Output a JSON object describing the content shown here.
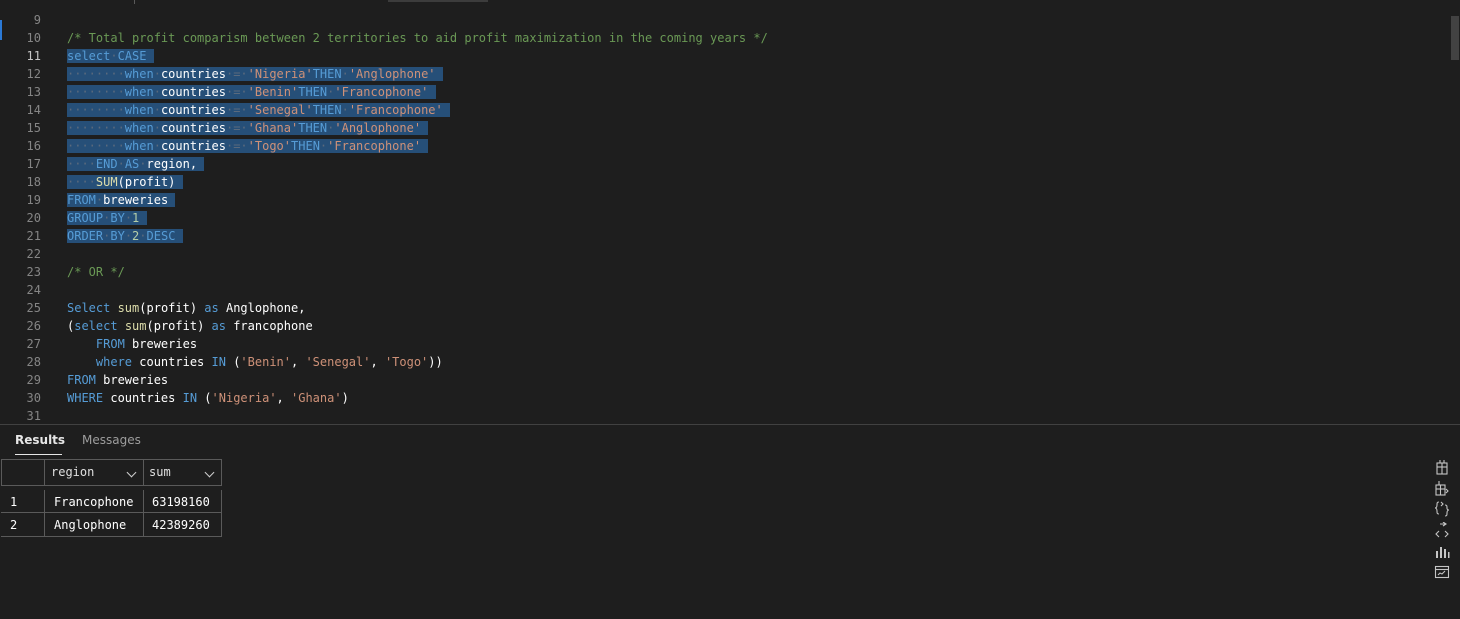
{
  "editor": {
    "lines": [
      {
        "n": "9",
        "segs": []
      },
      {
        "n": "10",
        "segs": [
          {
            "t": "/* Total profit comparism between 2 territories to aid profit maximization in the coming years */",
            "c": "cm"
          }
        ]
      },
      {
        "n": "11",
        "active": true,
        "segs": [
          {
            "t": "select",
            "c": "kw",
            "s": 1
          },
          {
            "t": "·",
            "c": "ws",
            "s": 1
          },
          {
            "t": "CASE",
            "c": "kw",
            "s": 1
          },
          {
            "t": " ",
            "c": "pl",
            "s": 1
          }
        ]
      },
      {
        "n": "12",
        "segs": [
          {
            "t": "········",
            "c": "ws",
            "s": 1
          },
          {
            "t": "when",
            "c": "kw",
            "s": 1
          },
          {
            "t": "·",
            "c": "ws",
            "s": 1
          },
          {
            "t": "countries",
            "c": "id",
            "s": 1
          },
          {
            "t": "·=·",
            "c": "ws",
            "s": 1
          },
          {
            "t": "'Nigeria'",
            "c": "st",
            "s": 1
          },
          {
            "t": "THEN",
            "c": "kw",
            "s": 1
          },
          {
            "t": "·",
            "c": "ws",
            "s": 1
          },
          {
            "t": "'Anglophone'",
            "c": "st",
            "s": 1
          },
          {
            "t": " ",
            "c": "pl",
            "s": 1
          }
        ]
      },
      {
        "n": "13",
        "segs": [
          {
            "t": "········",
            "c": "ws",
            "s": 1
          },
          {
            "t": "when",
            "c": "kw",
            "s": 1
          },
          {
            "t": "·",
            "c": "ws",
            "s": 1
          },
          {
            "t": "countries",
            "c": "id",
            "s": 1
          },
          {
            "t": "·=·",
            "c": "ws",
            "s": 1
          },
          {
            "t": "'Benin'",
            "c": "st",
            "s": 1
          },
          {
            "t": "THEN",
            "c": "kw",
            "s": 1
          },
          {
            "t": "·",
            "c": "ws",
            "s": 1
          },
          {
            "t": "'Francophone'",
            "c": "st",
            "s": 1
          },
          {
            "t": " ",
            "c": "pl",
            "s": 1
          }
        ]
      },
      {
        "n": "14",
        "segs": [
          {
            "t": "········",
            "c": "ws",
            "s": 1
          },
          {
            "t": "when",
            "c": "kw",
            "s": 1
          },
          {
            "t": "·",
            "c": "ws",
            "s": 1
          },
          {
            "t": "countries",
            "c": "id",
            "s": 1
          },
          {
            "t": "·=·",
            "c": "ws",
            "s": 1
          },
          {
            "t": "'Senegal'",
            "c": "st",
            "s": 1
          },
          {
            "t": "THEN",
            "c": "kw",
            "s": 1
          },
          {
            "t": "·",
            "c": "ws",
            "s": 1
          },
          {
            "t": "'Francophone'",
            "c": "st",
            "s": 1
          },
          {
            "t": " ",
            "c": "pl",
            "s": 1
          }
        ]
      },
      {
        "n": "15",
        "segs": [
          {
            "t": "········",
            "c": "ws",
            "s": 1
          },
          {
            "t": "when",
            "c": "kw",
            "s": 1
          },
          {
            "t": "·",
            "c": "ws",
            "s": 1
          },
          {
            "t": "countries",
            "c": "id",
            "s": 1
          },
          {
            "t": "·=·",
            "c": "ws",
            "s": 1
          },
          {
            "t": "'Ghana'",
            "c": "st",
            "s": 1
          },
          {
            "t": "THEN",
            "c": "kw",
            "s": 1
          },
          {
            "t": "·",
            "c": "ws",
            "s": 1
          },
          {
            "t": "'Anglophone'",
            "c": "st",
            "s": 1
          },
          {
            "t": " ",
            "c": "pl",
            "s": 1
          }
        ]
      },
      {
        "n": "16",
        "segs": [
          {
            "t": "········",
            "c": "ws",
            "s": 1
          },
          {
            "t": "when",
            "c": "kw",
            "s": 1
          },
          {
            "t": "·",
            "c": "ws",
            "s": 1
          },
          {
            "t": "countries",
            "c": "id",
            "s": 1
          },
          {
            "t": "·=·",
            "c": "ws",
            "s": 1
          },
          {
            "t": "'Togo'",
            "c": "st",
            "s": 1
          },
          {
            "t": "THEN",
            "c": "kw",
            "s": 1
          },
          {
            "t": "·",
            "c": "ws",
            "s": 1
          },
          {
            "t": "'Francophone'",
            "c": "st",
            "s": 1
          },
          {
            "t": " ",
            "c": "pl",
            "s": 1
          }
        ]
      },
      {
        "n": "17",
        "segs": [
          {
            "t": "····",
            "c": "ws",
            "s": 1
          },
          {
            "t": "END",
            "c": "kw",
            "s": 1
          },
          {
            "t": "·",
            "c": "ws",
            "s": 1
          },
          {
            "t": "AS",
            "c": "kw",
            "s": 1
          },
          {
            "t": "·",
            "c": "ws",
            "s": 1
          },
          {
            "t": "region,",
            "c": "id",
            "s": 1
          },
          {
            "t": " ",
            "c": "pl",
            "s": 1
          }
        ]
      },
      {
        "n": "18",
        "segs": [
          {
            "t": "····",
            "c": "ws",
            "s": 1
          },
          {
            "t": "SUM",
            "c": "fn",
            "s": 1
          },
          {
            "t": "(profit)",
            "c": "id",
            "s": 1
          },
          {
            "t": " ",
            "c": "pl",
            "s": 1
          }
        ]
      },
      {
        "n": "19",
        "segs": [
          {
            "t": "FROM",
            "c": "kw",
            "s": 1
          },
          {
            "t": "·",
            "c": "ws",
            "s": 1
          },
          {
            "t": "breweries",
            "c": "id",
            "s": 1
          },
          {
            "t": " ",
            "c": "pl",
            "s": 1
          }
        ]
      },
      {
        "n": "20",
        "segs": [
          {
            "t": "GROUP",
            "c": "kw",
            "s": 1
          },
          {
            "t": "·",
            "c": "ws",
            "s": 1
          },
          {
            "t": "BY",
            "c": "kw",
            "s": 1
          },
          {
            "t": "·",
            "c": "ws",
            "s": 1
          },
          {
            "t": "1",
            "c": "nm",
            "s": 1
          },
          {
            "t": " ",
            "c": "pl",
            "s": 1
          }
        ]
      },
      {
        "n": "21",
        "segs": [
          {
            "t": "ORDER",
            "c": "kw",
            "s": 1
          },
          {
            "t": "·",
            "c": "ws",
            "s": 1
          },
          {
            "t": "BY",
            "c": "kw",
            "s": 1
          },
          {
            "t": "·",
            "c": "ws",
            "s": 1
          },
          {
            "t": "2",
            "c": "nm",
            "s": 1
          },
          {
            "t": "·",
            "c": "ws",
            "s": 1
          },
          {
            "t": "DESC",
            "c": "kw",
            "s": 1
          },
          {
            "t": " ",
            "c": "pl",
            "s": 1
          }
        ]
      },
      {
        "n": "22",
        "segs": []
      },
      {
        "n": "23",
        "segs": [
          {
            "t": "/* OR */",
            "c": "cm"
          }
        ]
      },
      {
        "n": "24",
        "segs": []
      },
      {
        "n": "25",
        "segs": [
          {
            "t": "Select ",
            "c": "kw"
          },
          {
            "t": "sum",
            "c": "fn"
          },
          {
            "t": "(profit) ",
            "c": "id"
          },
          {
            "t": "as",
            "c": "kw"
          },
          {
            "t": " Anglophone,",
            "c": "id"
          }
        ]
      },
      {
        "n": "26",
        "segs": [
          {
            "t": "(",
            "c": "id"
          },
          {
            "t": "select ",
            "c": "kw"
          },
          {
            "t": "sum",
            "c": "fn"
          },
          {
            "t": "(profit) ",
            "c": "id"
          },
          {
            "t": "as",
            "c": "kw"
          },
          {
            "t": " francophone",
            "c": "id"
          }
        ]
      },
      {
        "n": "27",
        "segs": [
          {
            "t": "    ",
            "c": "pl"
          },
          {
            "t": "FROM",
            "c": "kw"
          },
          {
            "t": " breweries",
            "c": "id"
          }
        ]
      },
      {
        "n": "28",
        "segs": [
          {
            "t": "    ",
            "c": "pl"
          },
          {
            "t": "where",
            "c": "kw"
          },
          {
            "t": " countries ",
            "c": "id"
          },
          {
            "t": "IN",
            "c": "kw"
          },
          {
            "t": " (",
            "c": "id"
          },
          {
            "t": "'Benin'",
            "c": "st"
          },
          {
            "t": ", ",
            "c": "id"
          },
          {
            "t": "'Senegal'",
            "c": "st"
          },
          {
            "t": ", ",
            "c": "id"
          },
          {
            "t": "'Togo'",
            "c": "st"
          },
          {
            "t": "))",
            "c": "id"
          }
        ]
      },
      {
        "n": "29",
        "segs": [
          {
            "t": "FROM",
            "c": "kw"
          },
          {
            "t": " breweries",
            "c": "id"
          }
        ]
      },
      {
        "n": "30",
        "segs": [
          {
            "t": "WHERE",
            "c": "kw"
          },
          {
            "t": " countries ",
            "c": "id"
          },
          {
            "t": "IN",
            "c": "kw"
          },
          {
            "t": " (",
            "c": "id"
          },
          {
            "t": "'Nigeria'",
            "c": "st"
          },
          {
            "t": ", ",
            "c": "id"
          },
          {
            "t": "'Ghana'",
            "c": "st"
          },
          {
            "t": ")",
            "c": "id"
          }
        ]
      },
      {
        "n": "31",
        "segs": []
      }
    ]
  },
  "panel": {
    "tabs": {
      "results": "Results",
      "messages": "Messages"
    },
    "columns": [
      "region",
      "sum"
    ],
    "rows": [
      {
        "num": "1",
        "region": "Francophone",
        "sum": "63198160"
      },
      {
        "num": "2",
        "region": "Anglophone",
        "sum": "42389260"
      }
    ],
    "side_icons": [
      "save-as-csv-icon",
      "save-as-excel-icon",
      "save-as-json-icon",
      "save-as-xml-icon",
      "chart-icon",
      "visualizer-icon"
    ]
  },
  "colors": {
    "background": "#1e1e1e",
    "selection": "#264f78",
    "keyword": "#569cd6",
    "comment": "#6a9955",
    "string": "#ce9178",
    "function": "#dcdcaa"
  }
}
